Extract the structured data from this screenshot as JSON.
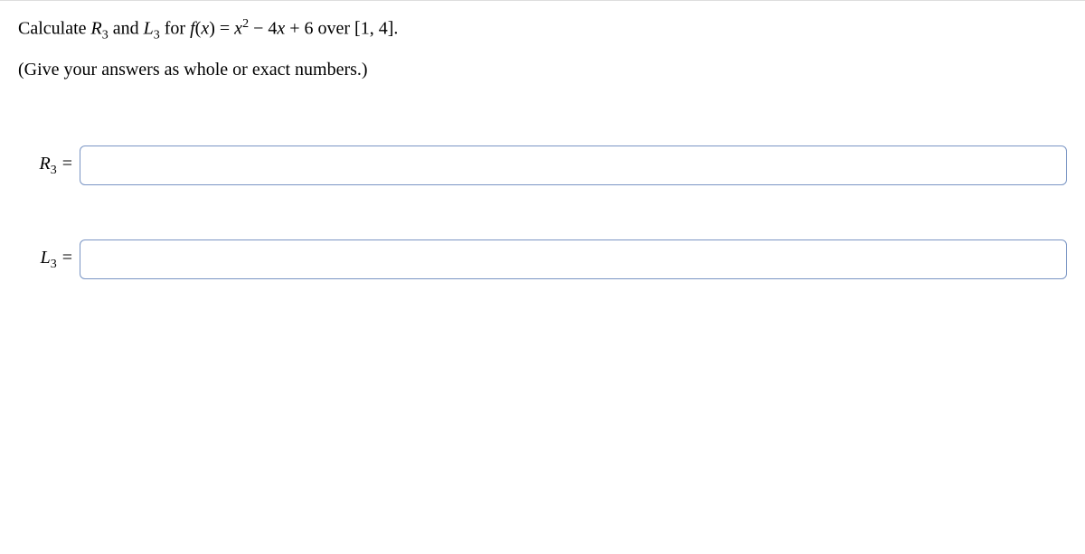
{
  "question": {
    "line1_prefix": "Calculate ",
    "var_R": "R",
    "sub_3a": "3",
    "and_text": " and ",
    "var_L": "L",
    "sub_3b": "3",
    "for_text": " for ",
    "func_f": "f",
    "paren_open": "(",
    "var_x1": "x",
    "paren_close_eq": ") = ",
    "var_x2": "x",
    "sup_2": "2",
    "minus_4x": " − 4",
    "var_x3": "x",
    "plus_6_over": " + 6 over [1, 4].",
    "line2": "(Give your answers as whole or exact numbers.)"
  },
  "answers": {
    "r3": {
      "var": "R",
      "sub": "3",
      "eq": "=",
      "value": ""
    },
    "l3": {
      "var": "L",
      "sub": "3",
      "eq": "=",
      "value": ""
    }
  }
}
